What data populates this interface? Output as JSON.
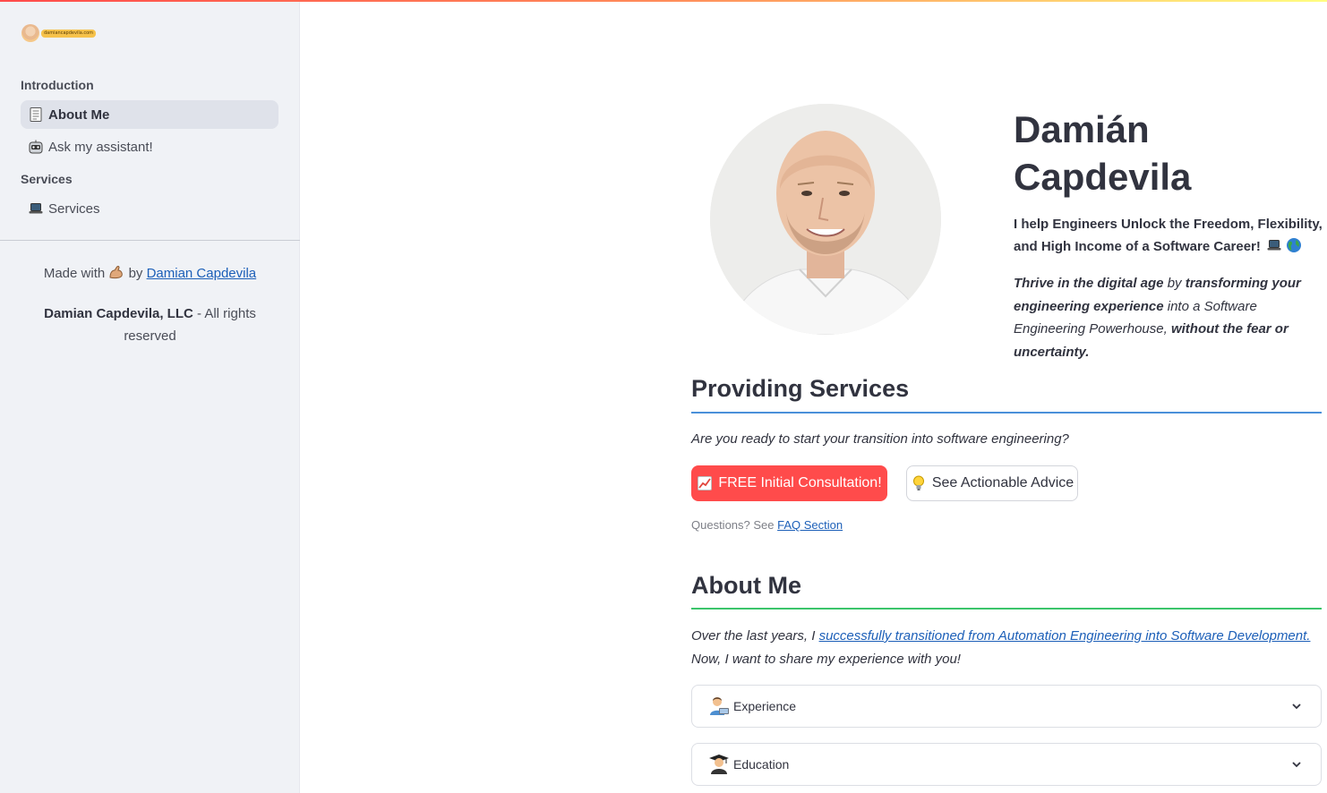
{
  "sidebar": {
    "logo_text": "damiancapdevila.com",
    "sections": [
      {
        "heading": "Introduction",
        "items": [
          {
            "label": "About Me",
            "icon": "page-icon",
            "active": true
          },
          {
            "label": "Ask my assistant!",
            "icon": "robot-icon",
            "active": false
          }
        ]
      },
      {
        "heading": "Services",
        "items": [
          {
            "label": "Services",
            "icon": "laptop-icon",
            "active": false
          }
        ]
      }
    ],
    "footer": {
      "made_with": "Made with",
      "by": "by",
      "author_link": "Damian Capdevila",
      "company": "Damian Capdevila, LLC",
      "rights": " - All rights reserved"
    }
  },
  "hero": {
    "name_line1": "Damián",
    "name_line2": "Capdevila",
    "tagline": "I help Engineers Unlock the Freedom, Flexibility, and High Income of a Software Career!",
    "description": {
      "part1": "Thrive in the digital age",
      "part2": " by ",
      "part3": "transforming your engineering experience",
      "part4": " into a Software Engineering Powerhouse, ",
      "part5": "without the fear or uncertainty."
    }
  },
  "services": {
    "title": "Providing Services",
    "subtitle": "Are you ready to start your transition into software engineering?",
    "primary_button": "FREE Initial Consultation!",
    "secondary_button": "See Actionable Advice",
    "faq_prefix": "Questions? See ",
    "faq_link": "FAQ Section"
  },
  "about": {
    "title": "About Me",
    "text_prefix": "Over the last years, I ",
    "text_link": "successfully transitioned from Automation Engineering into Software Development.",
    "text_suffix": "Now, I want to share my experience with you!",
    "expanders": [
      {
        "label": "Experience",
        "icon": "technologist-icon"
      },
      {
        "label": "Education",
        "icon": "graduate-icon"
      }
    ]
  },
  "colors": {
    "primary": "#ff4b4b",
    "link": "#1c5fb8",
    "services_underline": "#4a90d9",
    "about_underline": "#3cc46b",
    "sidebar_bg": "#f0f2f6"
  }
}
